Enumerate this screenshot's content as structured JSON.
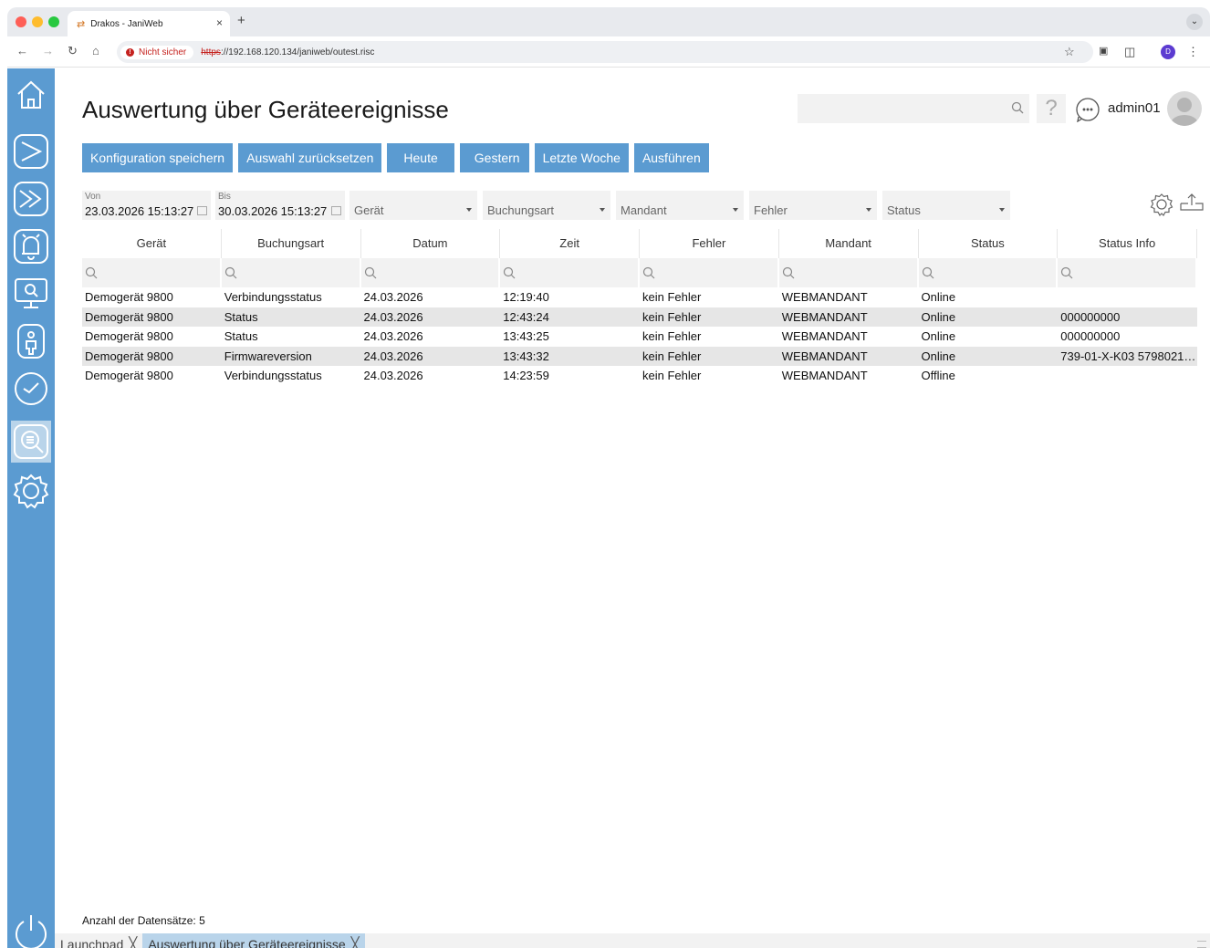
{
  "browser": {
    "tab_title": "Drakos - JaniWeb",
    "security_label": "Nicht sicher",
    "url_scheme": "https",
    "url_rest": "://192.168.120.134/janiweb/outest.risc",
    "profile_initial": "D"
  },
  "header": {
    "title": "Auswertung über Geräteereignisse",
    "username": "admin01",
    "help_glyph": "?"
  },
  "actions": [
    "Konfiguration speichern",
    "Auswahl zurücksetzen",
    "Heute",
    "Gestern",
    "Letzte Woche",
    "Ausführen"
  ],
  "filters": {
    "from_label": "Von",
    "from_value": "23.03.2026 15:13:27",
    "to_label": "Bis",
    "to_value": "30.03.2026 15:13:27",
    "dropdowns": [
      "Gerät",
      "Buchungsart",
      "Mandant",
      "Fehler",
      "Status"
    ]
  },
  "table": {
    "columns": [
      "Gerät",
      "Buchungsart",
      "Datum",
      "Zeit",
      "Fehler",
      "Mandant",
      "Status",
      "Status Info"
    ],
    "rows": [
      [
        "Demogerät 9800",
        "Verbindungsstatus",
        "24.03.2026",
        "12:19:40",
        "kein Fehler",
        "WEBMANDANT",
        "Online",
        ""
      ],
      [
        "Demogerät 9800",
        "Status",
        "24.03.2026",
        "12:43:24",
        "kein Fehler",
        "WEBMANDANT",
        "Online",
        "000000000"
      ],
      [
        "Demogerät 9800",
        "Status",
        "24.03.2026",
        "13:43:25",
        "kein Fehler",
        "WEBMANDANT",
        "Online",
        "000000000"
      ],
      [
        "Demogerät 9800",
        "Firmwareversion",
        "24.03.2026",
        "13:43:32",
        "kein Fehler",
        "WEBMANDANT",
        "Online",
        "739-01-X-K03 57980210..."
      ],
      [
        "Demogerät 9800",
        "Verbindungsstatus",
        "24.03.2026",
        "14:23:59",
        "kein Fehler",
        "WEBMANDANT",
        "Offline",
        ""
      ]
    ]
  },
  "footer": {
    "record_count": "Anzahl der Datensätze: 5",
    "tabs": [
      "Launchpad",
      "Auswertung über Geräteereignisse"
    ]
  },
  "sidebar": [
    "home-icon",
    "send-icon",
    "forward-icon",
    "bell-icon",
    "monitor-search-icon",
    "person-badge-icon",
    "clock-icon",
    "document-search-icon",
    "settings-icon"
  ],
  "colors": {
    "accent": "#5b9bd1",
    "active": "#b9d4ea",
    "stripe": "#e6e6e6"
  }
}
